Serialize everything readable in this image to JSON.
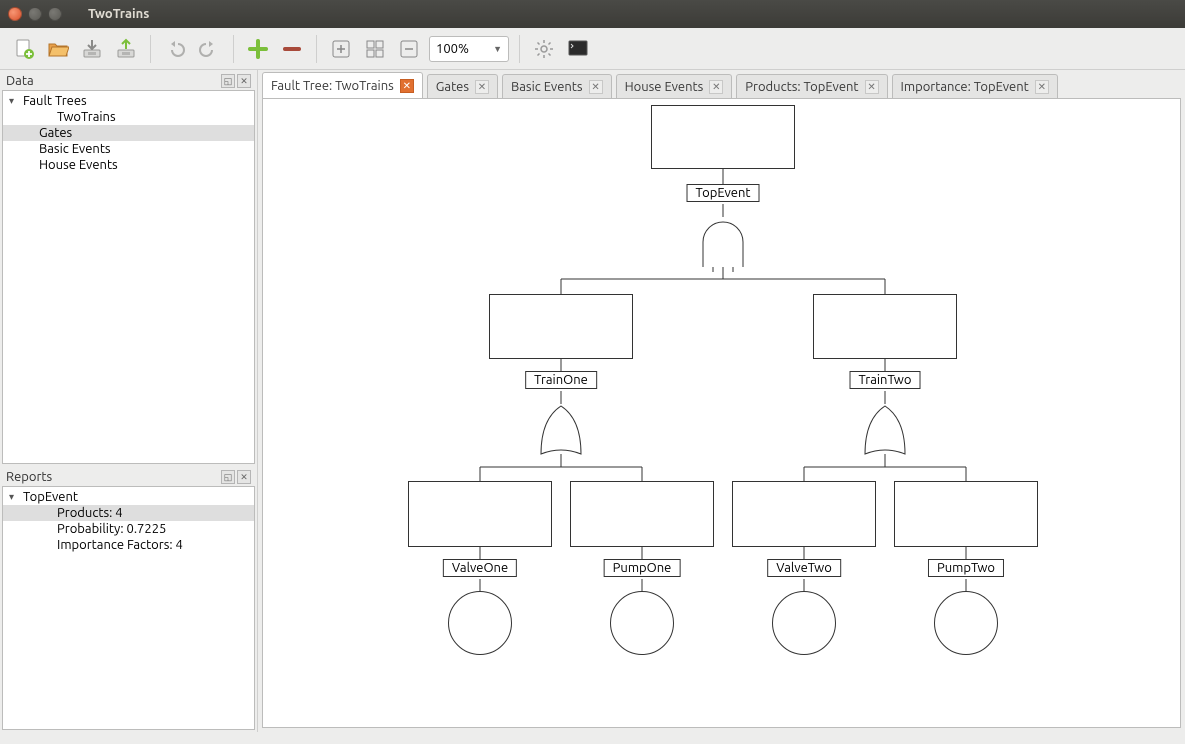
{
  "window": {
    "title": "TwoTrains"
  },
  "toolbar": {
    "zoom": "100%"
  },
  "data_panel": {
    "title": "Data",
    "tree": [
      {
        "label": "Fault Trees",
        "level": 0,
        "expandable": true,
        "selected": false
      },
      {
        "label": "TwoTrains",
        "level": 2,
        "expandable": false,
        "selected": false
      },
      {
        "label": "Gates",
        "level": 1,
        "expandable": false,
        "selected": true
      },
      {
        "label": "Basic Events",
        "level": 1,
        "expandable": false,
        "selected": false
      },
      {
        "label": "House Events",
        "level": 1,
        "expandable": false,
        "selected": false
      }
    ]
  },
  "reports_panel": {
    "title": "Reports",
    "tree": [
      {
        "label": "TopEvent",
        "level": 0,
        "expandable": true,
        "selected": false
      },
      {
        "label": "Products: 4",
        "level": 2,
        "expandable": false,
        "selected": true
      },
      {
        "label": "Probability: 0.7225",
        "level": 2,
        "expandable": false,
        "selected": false
      },
      {
        "label": "Importance Factors: 4",
        "level": 2,
        "expandable": false,
        "selected": false
      }
    ]
  },
  "tabs": [
    {
      "label": "Fault Tree: TwoTrains",
      "active": true
    },
    {
      "label": "Gates",
      "active": false
    },
    {
      "label": "Basic Events",
      "active": false
    },
    {
      "label": "House Events",
      "active": false
    },
    {
      "label": "Products: TopEvent",
      "active": false
    },
    {
      "label": "Importance: TopEvent",
      "active": false
    }
  ],
  "diagram": {
    "top": "TopEvent",
    "mid_left": "TrainOne",
    "mid_right": "TrainTwo",
    "leaf_1": "ValveOne",
    "leaf_2": "PumpOne",
    "leaf_3": "ValveTwo",
    "leaf_4": "PumpTwo"
  }
}
